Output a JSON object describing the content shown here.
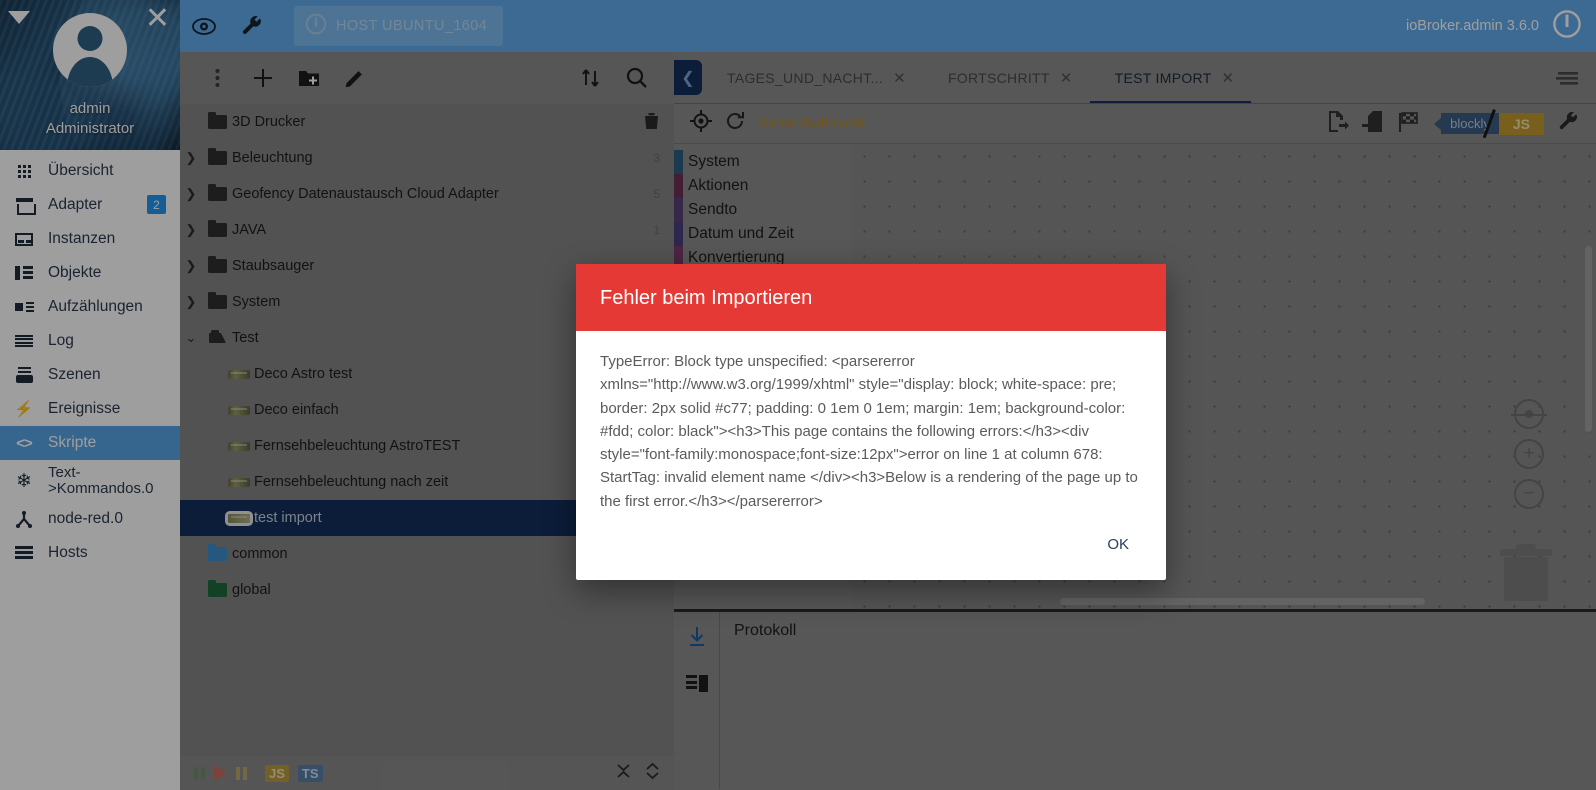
{
  "sidebar": {
    "user": {
      "name": "admin",
      "role": "Administrator"
    },
    "caret_icon": "triangle-down-icon",
    "close_icon": "close-icon",
    "items": [
      {
        "label": "Übersicht",
        "icon": "grid-icon"
      },
      {
        "label": "Adapter",
        "icon": "shop-icon",
        "badge": "2"
      },
      {
        "label": "Instanzen",
        "icon": "instances-icon"
      },
      {
        "label": "Objekte",
        "icon": "objects-list-icon"
      },
      {
        "label": "Aufzählungen",
        "icon": "enums-icon"
      },
      {
        "label": "Log",
        "icon": "log-lines-icon"
      },
      {
        "label": "Szenen",
        "icon": "scenes-icon"
      },
      {
        "label": "Ereignisse",
        "icon": "lightning-icon"
      },
      {
        "label": "Skripte",
        "icon": "code-brackets-icon",
        "active": true
      },
      {
        "label": "Text->Kommandos.0",
        "icon": "asterisk-icon"
      },
      {
        "label": "node-red.0",
        "icon": "node-red-icon"
      },
      {
        "label": "Hosts",
        "icon": "hosts-icon"
      }
    ]
  },
  "header": {
    "eye_icon": "eye-icon",
    "wrench_icon": "wrench-icon",
    "host_chip": "HOST UBUNTU_1604",
    "host_icon": "info-power-icon",
    "version": "ioBroker.admin 3.6.0",
    "power_icon": "power-icon"
  },
  "tree": {
    "toolbar": [
      {
        "name": "more-vert-icon",
        "label": "⋮"
      },
      {
        "name": "add-script-icon",
        "label": "+"
      },
      {
        "name": "new-folder-icon",
        "label": "folder+"
      },
      {
        "name": "edit-pencil-icon",
        "label": "pencil"
      },
      {
        "name": "sort-icon",
        "label": "sort"
      },
      {
        "name": "search-icon",
        "label": "search"
      }
    ],
    "rows": [
      {
        "label": "3D Drucker",
        "type": "folder",
        "expandable": false,
        "indent": 0,
        "trash": true
      },
      {
        "label": "Beleuchtung",
        "type": "folder",
        "expandable": true,
        "indent": 0,
        "count": "3"
      },
      {
        "label": "Geofency Datenaustausch Cloud Adapter",
        "type": "folder",
        "expandable": true,
        "indent": 0,
        "count": "5"
      },
      {
        "label": "JAVA",
        "type": "folder",
        "expandable": true,
        "indent": 0,
        "count": "1"
      },
      {
        "label": "Staubsauger",
        "type": "folder",
        "expandable": true,
        "indent": 0
      },
      {
        "label": "System",
        "type": "folder",
        "expandable": true,
        "indent": 0
      },
      {
        "label": "Test",
        "type": "folder-open",
        "expandable": true,
        "expanded": true,
        "indent": 0
      },
      {
        "label": "Deco Astro test",
        "type": "blockly",
        "indent": 1,
        "play": true
      },
      {
        "label": "Deco einfach",
        "type": "blockly",
        "indent": 1,
        "play": true
      },
      {
        "label": "Fernsehbeleuchtung AstroTEST",
        "type": "blockly",
        "indent": 1,
        "play": true
      },
      {
        "label": "Fernsehbeleuchtung nach zeit",
        "type": "blockly",
        "indent": 1,
        "play": true
      },
      {
        "label": "test import",
        "type": "blockly",
        "indent": 1,
        "play": true,
        "selected": true
      },
      {
        "label": "common",
        "type": "folder-blue",
        "indent": 0
      },
      {
        "label": "global",
        "type": "folder-green",
        "indent": 0
      }
    ],
    "footer": {
      "pause_icon": "pause-green-icon",
      "play_icon": "play-red-icon",
      "pause2_icon": "pause-amber-icon",
      "blockly_icon": "blockly-icon",
      "js_tag": "JS",
      "ts_tag": "TS",
      "collapse_icon": "collapse-all-icon",
      "expand_icon": "expand-all-icon"
    }
  },
  "editor": {
    "collapse_icon": "arrow-left-icon",
    "tabs": [
      {
        "label": "TAGES_UND_NACHT...",
        "icon": "blockly-icon",
        "active": false
      },
      {
        "label": "FORTSCHRITT",
        "icon": "blockly-icon",
        "active": false
      },
      {
        "label": "TEST IMPORT",
        "icon": "blockly-icon",
        "active": true
      }
    ],
    "tabs_menu_icon": "menu-icon",
    "run_bar": {
      "debug_icon": "target-icon",
      "reload_icon": "reload-icon",
      "status": "Skript läuft nicht",
      "export_icon": "export-icon",
      "import_icon": "import-icon",
      "flag_icon": "checkered-flag-icon",
      "mode_blockly": "blockly",
      "mode_js": "JS",
      "settings_icon": "wrench-icon"
    },
    "toolbox": [
      {
        "label": "System",
        "color": "#2d5e82"
      },
      {
        "label": "Aktionen",
        "color": "#6d3050"
      },
      {
        "label": "Sendto",
        "color": "#5a3f77"
      },
      {
        "label": "Datum und Zeit",
        "color": "#4a3f80"
      },
      {
        "label": "Konvertierung",
        "color": "#7a3a6a"
      }
    ],
    "workspace": {
      "center_icon": "center-target-icon",
      "zoom_in_icon": "zoom-in-icon",
      "zoom_out_icon": "zoom-out-icon",
      "trash_icon": "trash-icon"
    },
    "log": {
      "title": "Protokoll",
      "download_icon": "download-icon",
      "list_icon": "list-view-icon"
    }
  },
  "dialog": {
    "title": "Fehler beim Importieren",
    "message": "TypeError: Block type unspecified: <parsererror xmlns=\"http://www.w3.org/1999/xhtml\" style=\"display: block; white-space: pre; border: 2px solid #c77; padding: 0 1em 0 1em; margin: 1em; background-color: #fdd; color: black\"><h3>This page contains the following errors:</h3><div style=\"font-family:monospace;font-size:12px\">error on line 1 at column 678: StartTag: invalid element name </div><h3>Below is a rendering of the page up to the first error.</h3></parsererror>",
    "ok_label": "OK",
    "header_color": "#e53935"
  }
}
